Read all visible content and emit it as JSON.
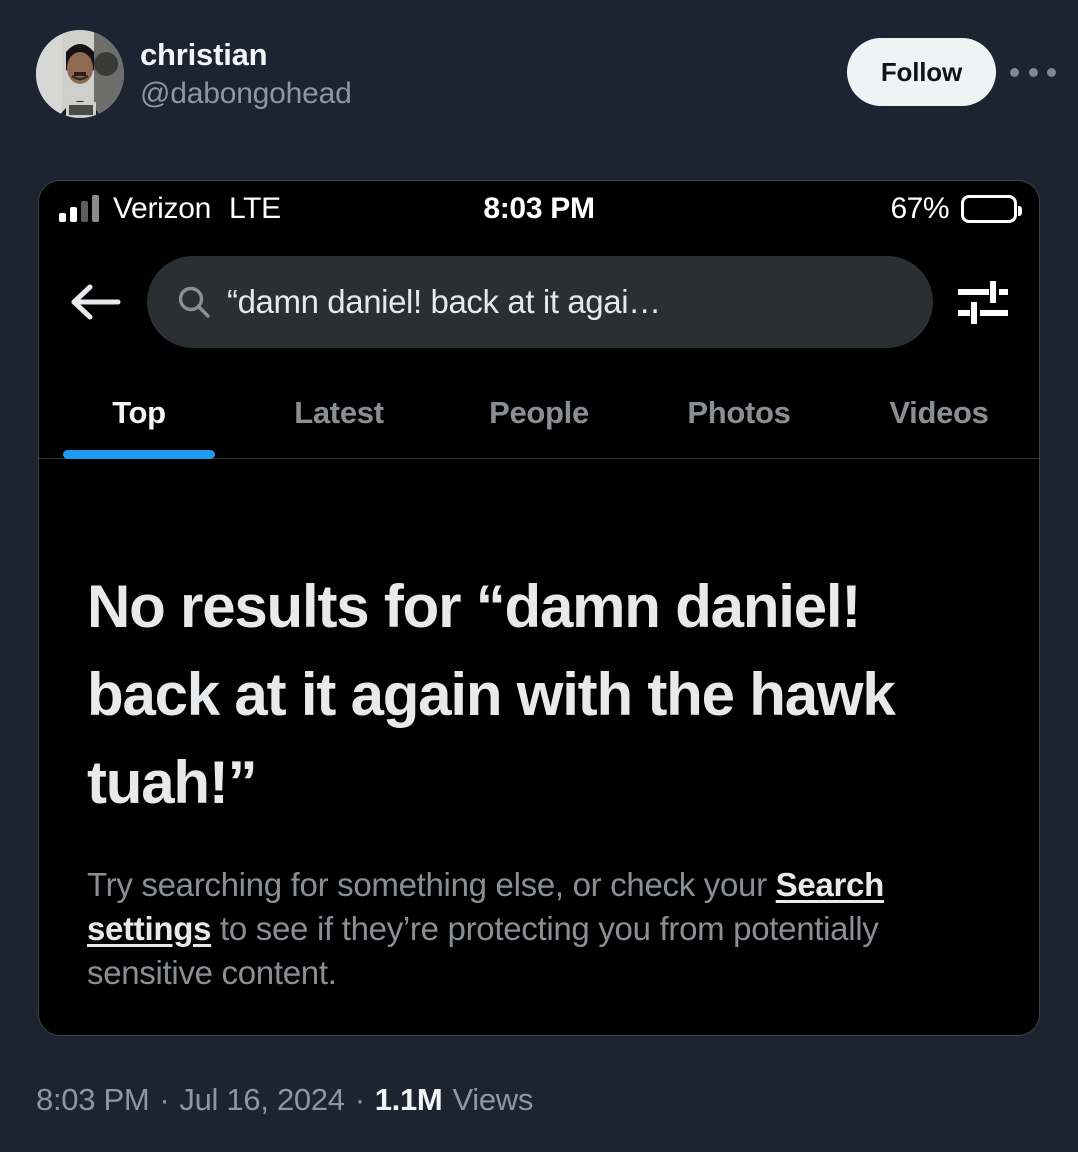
{
  "tweet": {
    "author": {
      "display_name": "christian",
      "handle": "@dabongohead",
      "avatar_alt": "grayscale-photo-of-person"
    },
    "follow_label": "Follow",
    "more_menu_label": "More",
    "footer": {
      "time": "8:03 PM",
      "separator": "·",
      "date": "Jul 16, 2024",
      "views_count": "1.1M",
      "views_label": "Views"
    }
  },
  "screenshot": {
    "status_bar": {
      "carrier": "Verizon",
      "network": "LTE",
      "clock": "8:03 PM",
      "battery_percent": "67%",
      "battery_level": 67
    },
    "search": {
      "back_label": "Back",
      "query": "“damn daniel! back at it agai…",
      "search_icon": "search-icon",
      "filter_icon": "filter-sliders-icon"
    },
    "tabs": [
      {
        "label": "Top",
        "active": true
      },
      {
        "label": "Latest",
        "active": false
      },
      {
        "label": "People",
        "active": false
      },
      {
        "label": "Photos",
        "active": false
      },
      {
        "label": "Videos",
        "active": false
      }
    ],
    "no_results": {
      "title": "No results for “damn daniel! back at it again with the hawk tuah!”",
      "desc_before": "Try searching for something else, or check your ",
      "link_text": "Search settings",
      "desc_after": " to see if they’re protecting you from potentially sensitive content."
    }
  },
  "colors": {
    "page_background": "#1b2430",
    "card_background": "#000000",
    "accent_blue": "#1d9bf0",
    "follow_button_bg": "#eff3f4",
    "primary_text": "#e7e9ea",
    "muted_text": "#8b8f94"
  }
}
